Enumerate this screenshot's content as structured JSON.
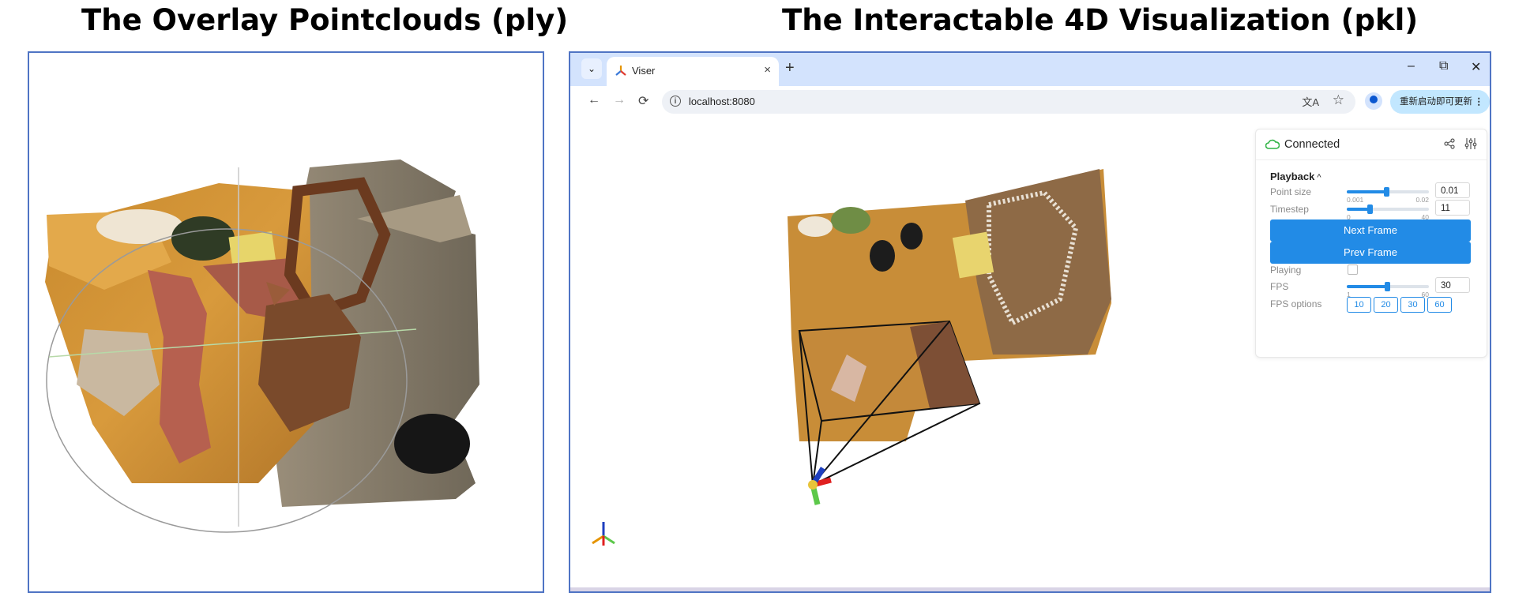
{
  "titles": {
    "left": "The Overlay Pointclouds (ply)",
    "right": "The Interactable 4D Visualization (pkl)"
  },
  "browser": {
    "tab_menu_icon": "chevron-down-icon",
    "tab_title": "Viser",
    "tab_close": "×",
    "new_tab": "+",
    "window_controls": {
      "minimize": "–",
      "restore": "⧉",
      "close": "✕"
    },
    "nav": {
      "back": "←",
      "forward": "→",
      "reload": "⟳"
    },
    "url": "localhost:8080",
    "update_label": "重新启动即可更新",
    "accent_color": "#d3e3fd"
  },
  "control_panel": {
    "status": "Connected",
    "status_color": "#2fb344",
    "section": "Playback",
    "point_size": {
      "label": "Point size",
      "min": "0.001",
      "max": "0.02",
      "value": "0.01",
      "fraction": 0.48
    },
    "timestep": {
      "label": "Timestep",
      "min": "0",
      "max": "40",
      "value": "11",
      "fraction": 0.275
    },
    "next_frame": "Next Frame",
    "prev_frame": "Prev Frame",
    "playing": {
      "label": "Playing",
      "checked": false
    },
    "fps": {
      "label": "FPS",
      "min": "1",
      "max": "60",
      "value": "30",
      "fraction": 0.49
    },
    "fps_options": {
      "label": "FPS options",
      "values": [
        "10",
        "20",
        "30",
        "60"
      ]
    },
    "button_color": "#228be6"
  }
}
